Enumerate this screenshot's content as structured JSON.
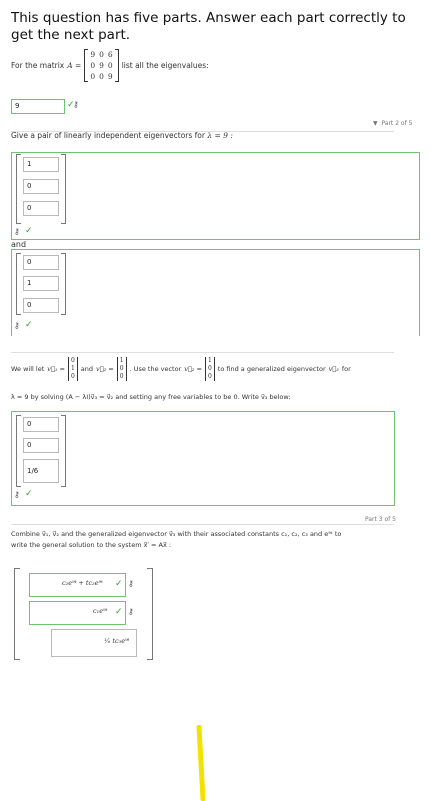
{
  "header": {
    "title": "This question has five parts. Answer each part correctly to get the next part."
  },
  "part1": {
    "prompt_pre": "For the matrix",
    "matrix_var": "A =",
    "matrix": [
      [
        "9",
        "0",
        "6"
      ],
      [
        "0",
        "9",
        "0"
      ],
      [
        "0",
        "0",
        "9"
      ]
    ],
    "prompt_post": "list all the eigenvalues:",
    "answer": "9"
  },
  "part2": {
    "indicator": "Part 2 of 5",
    "prompt": "Give a pair of linearly independent eigenvectors for",
    "lambda": "λ = 9 :",
    "vec1": [
      "1",
      "0",
      "0"
    ],
    "and_label": "and",
    "vec2": [
      "0",
      "1",
      "0"
    ]
  },
  "part4": {
    "t1": "We will let",
    "v1_lbl": "v⃗₁ =",
    "v1": [
      "0",
      "1",
      "0"
    ],
    "and": "and",
    "v2_lbl": "v⃗₂ =",
    "v2": [
      "1",
      "0",
      "0"
    ],
    "t2": ". Use the vector",
    "v2b_lbl": "v⃗₂ =",
    "v2b": [
      "1",
      "0",
      "0"
    ],
    "t3": "to find a generalized eigenvector",
    "v3_lbl": "v⃗₃",
    "t4": "for",
    "line2": "λ = 9 by solving (A − λI)v⃗₃ = v⃗₂ and setting any free variables to be 0. Write v⃗₃ below:",
    "answer": [
      "0",
      "0",
      "1/6"
    ]
  },
  "part5": {
    "indicator": "Part 3 of 5",
    "prompt1": "Combine v⃗₁, v⃗₂ and the generalized eigenvector v⃗₃ with their associated constants c₁, c₂, c₃ and e⁹ᵗ to",
    "prompt2": "write the general solution to the system x⃗′ = Ax⃗ :",
    "row1": "c₂e⁹ᵗ + tc₃e⁹ᵗ",
    "row2": "c₁e⁹ᵗ",
    "row3": "¹⁄₆ tc₃e⁹ᵗ"
  },
  "colors": {
    "correct": "#2ea32e",
    "box_border": "#6ec46e",
    "pen_mark": "#f2e200"
  }
}
